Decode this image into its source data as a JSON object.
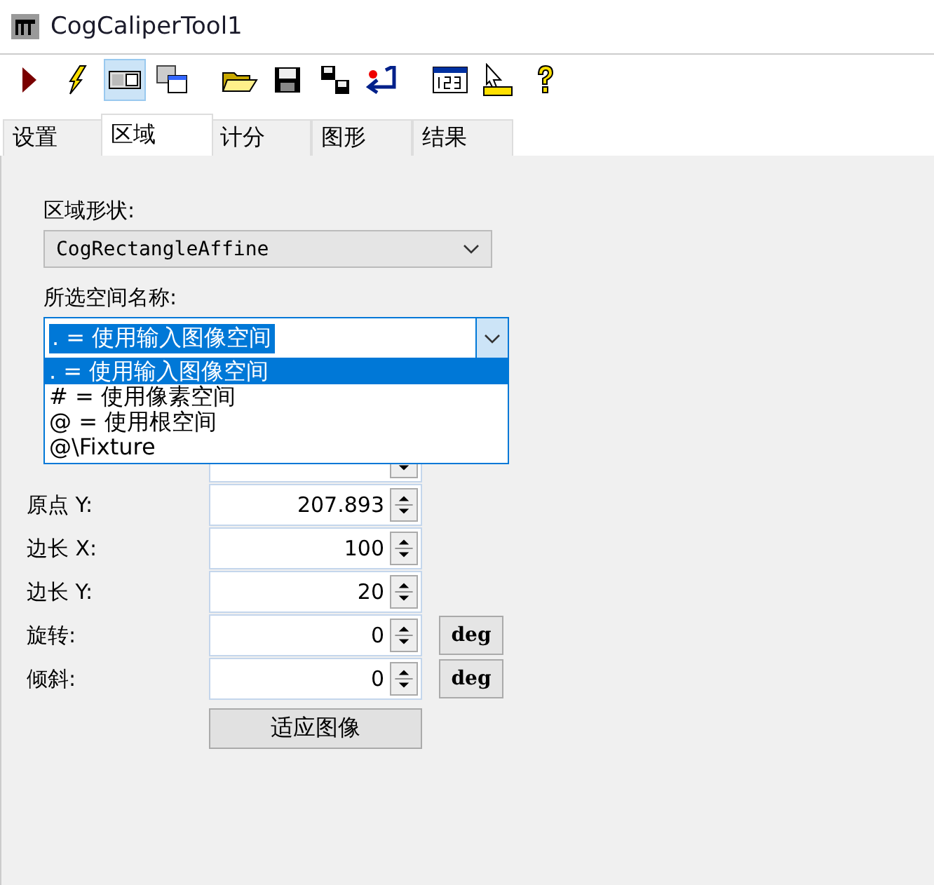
{
  "window": {
    "title": "CogCaliperTool1"
  },
  "toolbar": [
    {
      "kind": "run",
      "selected": false
    },
    {
      "kind": "bolt",
      "selected": false
    },
    {
      "kind": "panel",
      "selected": true
    },
    {
      "kind": "panel2",
      "selected": false
    },
    {
      "kind": "open",
      "selected": false
    },
    {
      "kind": "save",
      "selected": false
    },
    {
      "kind": "saveas",
      "selected": false
    },
    {
      "kind": "reset",
      "selected": false
    },
    {
      "kind": "numbers",
      "selected": false
    },
    {
      "kind": "ruler",
      "selected": false
    },
    {
      "kind": "help",
      "selected": false
    }
  ],
  "tabs": [
    {
      "label": "设置",
      "selected": false
    },
    {
      "label": "区域",
      "selected": true
    },
    {
      "label": "计分",
      "selected": false
    },
    {
      "label": "图形",
      "selected": false
    },
    {
      "label": "结果",
      "selected": false
    }
  ],
  "region_shape": {
    "label": "区域形状:",
    "value": "CogRectangleAffine"
  },
  "space_name": {
    "label": "所选空间名称:",
    "value": ". = 使用输入图像空间",
    "expanded": true,
    "options": [
      {
        "label": ". = 使用输入图像空间",
        "selected": true
      },
      {
        "label": "# = 使用像素空间",
        "selected": false
      },
      {
        "label": "@ = 使用根空间",
        "selected": false
      },
      {
        "label": "@\\Fixture",
        "selected": false
      }
    ]
  },
  "fields": [
    {
      "label": "原点 Y:",
      "value": "207.893"
    },
    {
      "label": "边长 X:",
      "value": "100"
    },
    {
      "label": "边长 Y:",
      "value": "20"
    },
    {
      "label": "旋转:",
      "value": "0",
      "unit": "deg"
    },
    {
      "label": "倾斜:",
      "value": "0",
      "unit": "deg"
    }
  ],
  "fit_button": "适应图像"
}
